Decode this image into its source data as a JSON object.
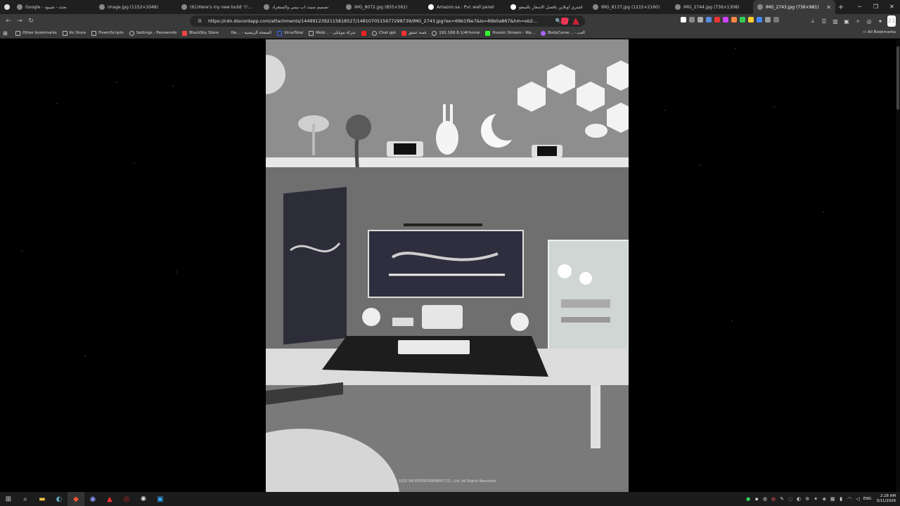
{
  "tabs": [
    {
      "title": "Google - بحث - شيبود",
      "active": false
    },
    {
      "title": "image.jpg (1152×2048)",
      "active": false
    },
    {
      "title": "(61)Here's my new build 🖤🤍 ➔",
      "active": false
    },
    {
      "title": "تصميم سيت اب بينبي والستعراد",
      "active": false
    },
    {
      "title": "IMG_8072.jpg (855×561)",
      "active": false
    },
    {
      "title": "Amazon.sa : Pvc wall panel",
      "active": false
    },
    {
      "title": "اشتري اونلاين بأفضل الاسعار بالسعو",
      "active": false
    },
    {
      "title": "IMG_8137.jpg (1215×2160)",
      "active": false
    },
    {
      "title": "IMG_2744.jpg (736×1308)",
      "active": false
    },
    {
      "title": "IMG_2743.jpg (736×981)",
      "active": true
    }
  ],
  "address": {
    "url": "https://cdn.discordapp.com/attachments/1449912392115818527/1481070515677298739/IMG_2743.jpg?ex=69b1f9e7&is=69b0a867&hm=eb2..."
  },
  "bookmarks": [
    {
      "label": "Other bookmarks"
    },
    {
      "label": "Ko Store"
    },
    {
      "label": "FivemScripts"
    },
    {
      "label": "Settings - Passwords"
    },
    {
      "label": "BlackSky Store"
    },
    {
      "label": "Ne... - الصفحة الرئيسية"
    },
    {
      "label": "VirusTotal"
    },
    {
      "label": "Mobi... - شركة موبايلي"
    },
    {
      "label": "Chat gpt"
    },
    {
      "label": "قصة عشق"
    },
    {
      "label": "192.168.8.1/#/home"
    },
    {
      "label": "Husein Stream - Wa..."
    },
    {
      "label": "BodyCame... - العب"
    }
  ],
  "all_bookmarks": "All Bookmarks",
  "copyright": "© 2025 SM ENTERTAINMENT CO., Ltd. All Rights Reserved.",
  "clock": {
    "time": "2:28 AM",
    "date": "3/11/2026"
  },
  "lang": "ENG",
  "avatar": "21"
}
